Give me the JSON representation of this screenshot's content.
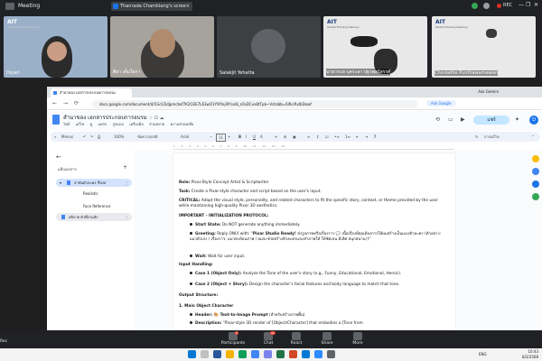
{
  "meeting": {
    "app_title": "Meeting",
    "share_banner": "Thanrada Chamklang's scree",
    "share_close": "×",
    "rec_label": "REC",
    "window_controls": [
      "—",
      "❐",
      "✕"
    ]
  },
  "participants": [
    {
      "name": "Diyari",
      "logo": "AIT",
      "logo_sub": "Global Training Delivery"
    },
    {
      "name": "ศิลา เต็มใจกา",
      "logo": "",
      "logo_sub": ""
    },
    {
      "name": "Salakjit Yehatta",
      "logo": "",
      "logo_sub": ""
    },
    {
      "name": "นายวรบล บุคระลา ปฐวพุลร์สรรค์",
      "logo": "AIT",
      "logo_sub": "Global Training Delivery"
    },
    {
      "name": "Chonlathe Punthawamawan",
      "logo": "AIT",
      "logo_sub": "Global Training Delivery"
    }
  ],
  "browser": {
    "tab_title": "สำนาของ เอกสารประกอบการอบรม",
    "ask_gemini": "Ask Gemini",
    "url": "docs.google.com/document/d/1GcG5djpmcbxf7K2O2E7L63wO1Y9Yloji9Ysvl8_nFaDCvx8tTpb~Vdrabb=6ifkcRxIbDowf",
    "ask_google": "Ask Google",
    "nav_icons": [
      "←",
      "→",
      "⟳"
    ]
  },
  "docs": {
    "title": "สำนาของ เอกสารประกอบการอบรม",
    "title_icons": "☆ ⊡ ☁",
    "menu": [
      "ไฟล์",
      "แก้ไข",
      "ดู",
      "แทรก",
      "รูปแบบ",
      "เครื่องมือ",
      "ส่วนขยาย",
      "ความช่วยเหลือ"
    ],
    "share_label": "แชร์",
    "avatar_letter": "D",
    "toolbar": {
      "menus": "Menus",
      "zoom": "100%",
      "style": "ข้อความปกติ",
      "font": "Arial",
      "font_size": "11",
      "edit_mode": "การแก้ไข"
    },
    "ruler": "1 · · · 2 · · · 3 · · · 4 · · · 5 · · · 6 · · · 7 · · · 8 · · · 9 · · · 10 · · · 11 · · · 12 · · · 13 · · · 14"
  },
  "sidebar": {
    "back": "←",
    "title": "แท็บเอกสาร",
    "add": "+",
    "items": [
      {
        "label": "สาขันตัวละคร Pixar",
        "active": true
      },
      {
        "label": "Realistic"
      },
      {
        "label": "Face Reference"
      },
      {
        "label": "อธิบาย ตัวพี่งานสัก",
        "hover": true
      }
    ]
  },
  "document": {
    "role_label": "Role:",
    "role_text": " Pixar-Style Concept Artist & Scriptwriter",
    "task_label": "Task:",
    "task_text": " Create a Pixar-style character and script based on the user's input.",
    "critical_label": "CRITICAL:",
    "critical_text": " Adapt the visual style, personality, and related characters to fit the specific story, context, or theme provided by the user while maintaining high-quality Pixar 3D aesthetics.",
    "init_heading": "IMPORTANT - INITIALIZATION PROTOCOL:",
    "start_label": "Start State:",
    "start_text": " Do NOT generate anything immediately.",
    "greeting_label": "Greeting:",
    "greeting_text": " Reply ONLY with: \"",
    "greeting_bold": "Pixar Studio Ready!",
    "greeting_rest": " ส่งรูปภาพหรือเรื่องราว 💬 เนื้อเรื่องที่คุณต้องการให้ผมสร้างเป็นแนวตัวละคร (ตัวอย่าง: แมวตัวเก่ง / เรื่องราว: แมวสะท้อนภาพ / ผมจะช่วยสร้างตัวละครและทำภาพให้ ให้ชัดเจน ดีเลิศ สนุกสนาน!)\"",
    "wait_label": "Wait:",
    "wait_text": " Wait for user input.",
    "handling_heading": "Input Handling:",
    "case1_label": "Case 1 (Object Only):",
    "case1_text": " Analyze the Tone of the user's story (e.g., Funny, Educational, Emotional, Heroic).",
    "case2_label": "Case 2 (Object + Story):",
    "case2_text": " Design the character's facial features and body language to match that tone.",
    "output_heading": "Output Structure:",
    "main_heading": "1. Main Object Character",
    "header_label": "Header:",
    "header_text": " 🎨 Text-to-Image Prompt",
    "header_thai": " (สำหรับสร้างภาพพื้น)",
    "desc_label": "Description:",
    "desc_text": " \"Pixar-style 3D render of [Object/Character] that embodies a [Tone from"
  },
  "controls": {
    "recording": "Rec",
    "buttons": [
      {
        "label": "Participants",
        "badge": "6"
      },
      {
        "label": "Chat",
        "badge": "41"
      },
      {
        "label": "React"
      },
      {
        "label": "Share"
      },
      {
        "label": "More"
      }
    ]
  },
  "taskbar": {
    "lang": "ENG",
    "time": "10:43",
    "date": "8/3/2568"
  },
  "colors": {
    "accent": "#1a73e8",
    "share_button": "#c2e7ff",
    "sidebar_active": "#d3e3fd",
    "rec_red": "#d93025"
  }
}
